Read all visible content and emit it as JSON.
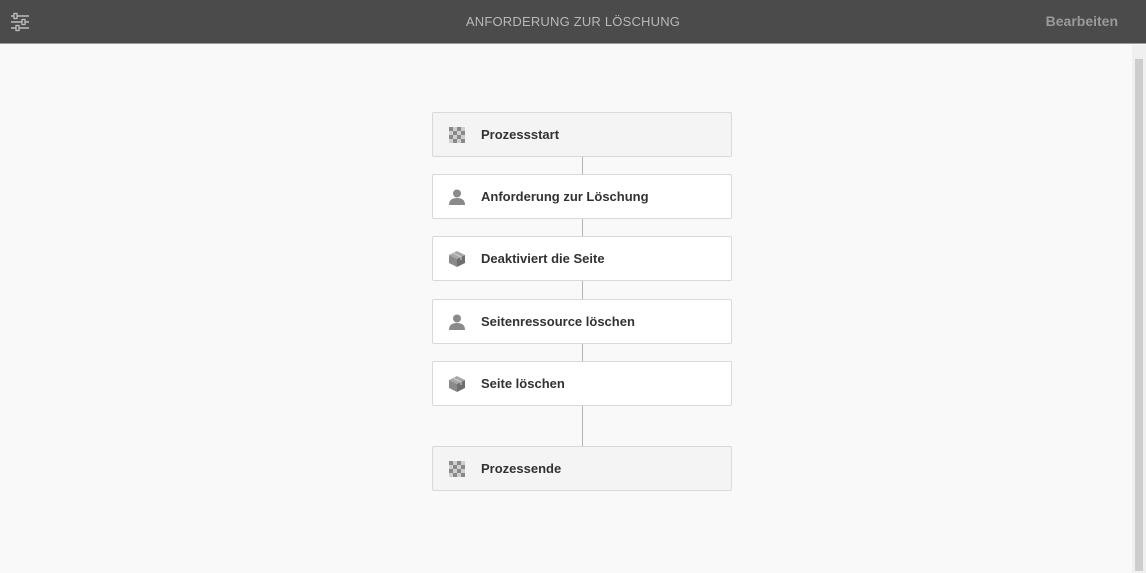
{
  "header": {
    "title": "ANFORDERUNG ZUR LÖSCHUNG",
    "edit_label": "Bearbeiten",
    "settings_icon": "sliders-icon"
  },
  "colors": {
    "header_bg": "#4b4b4b",
    "page_bg": "#f9f9f9",
    "step_bg": "#ffffff",
    "flow_step_bg": "#f4f4f4",
    "icon": "#8a8a8a"
  },
  "workflow": {
    "steps": [
      {
        "label": "Prozessstart",
        "icon": "checker-flag-icon",
        "kind": "flow"
      },
      {
        "label": "Anforderung zur Löschung",
        "icon": "user-icon",
        "kind": "participant"
      },
      {
        "label": "Deaktiviert die Seite",
        "icon": "cube-icon",
        "kind": "process"
      },
      {
        "label": "Seitenressource löschen",
        "icon": "user-icon",
        "kind": "participant"
      },
      {
        "label": "Seite löschen",
        "icon": "cube-icon",
        "kind": "process"
      },
      {
        "label": "Prozessende",
        "icon": "checker-flag-icon",
        "kind": "flow"
      }
    ]
  }
}
